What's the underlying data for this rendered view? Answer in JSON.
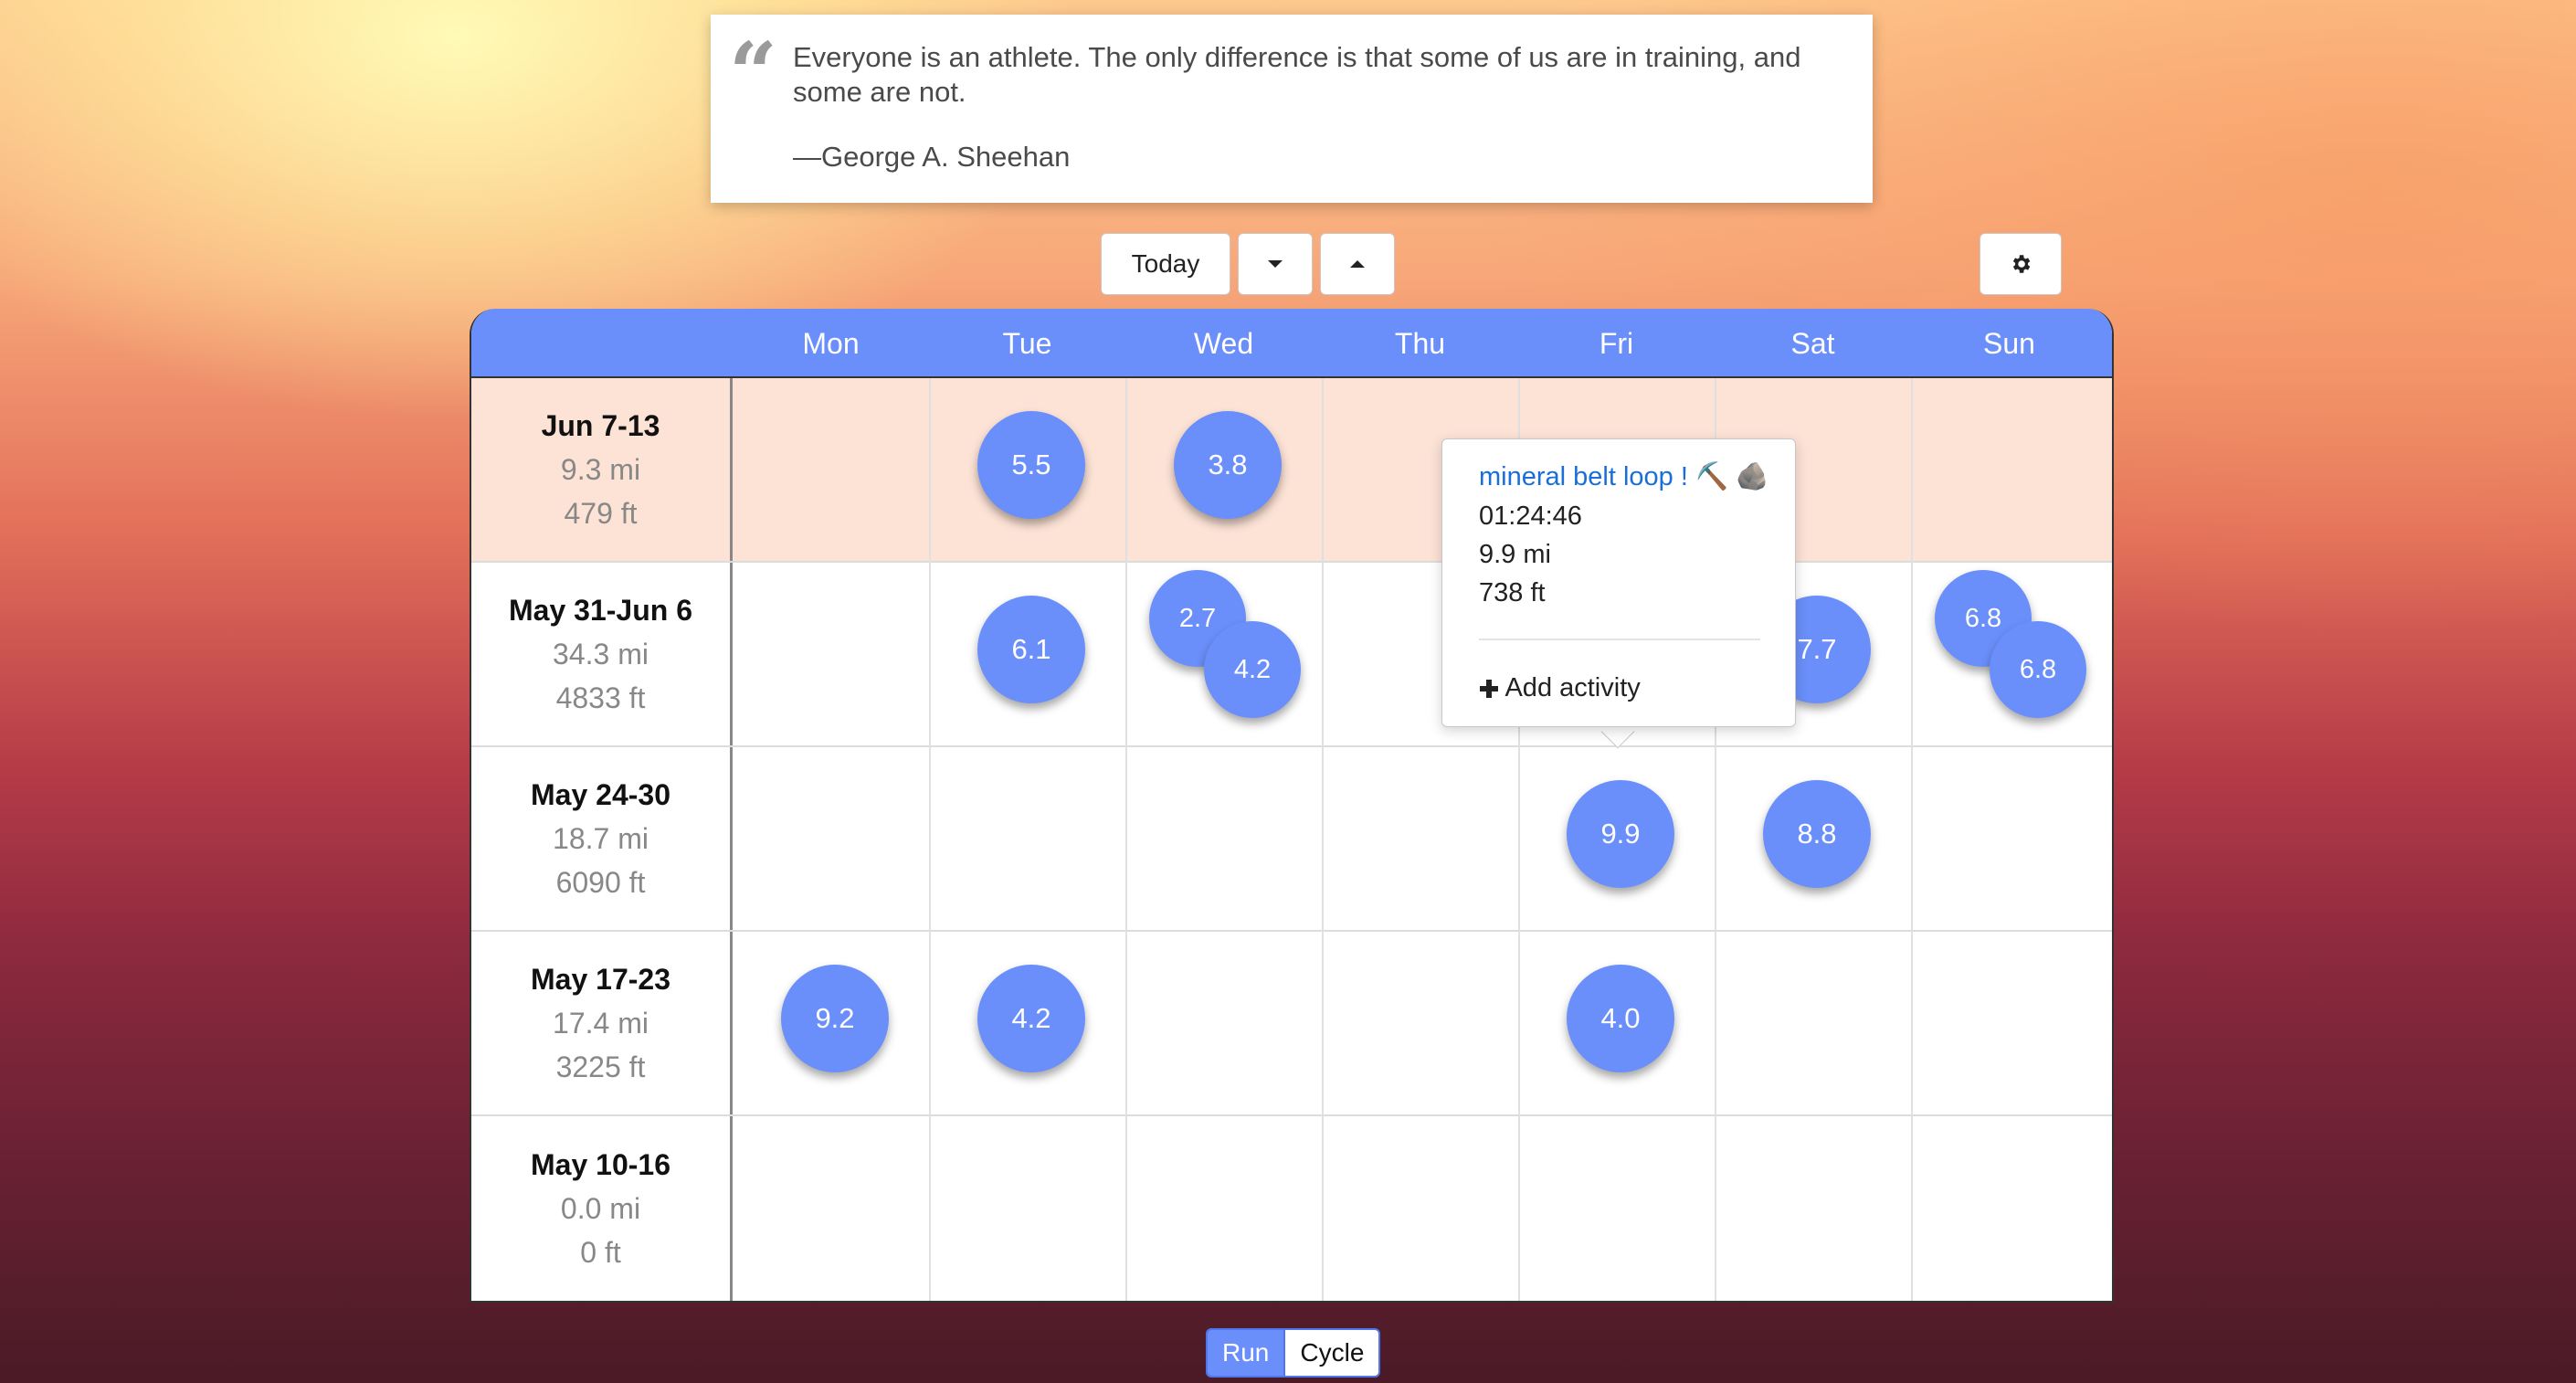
{
  "quote": {
    "mark": "“",
    "text": "Everyone is an athlete. The only difference is that some of us are in training, and some are not.",
    "author": "—George A. Sheehan"
  },
  "toolbar": {
    "today_label": "Today",
    "prev_icon": "caret-down-icon",
    "next_icon": "caret-up-icon",
    "settings_icon": "gear-icon"
  },
  "calendar": {
    "days": [
      "Mon",
      "Tue",
      "Wed",
      "Thu",
      "Fri",
      "Sat",
      "Sun"
    ],
    "weeks": [
      {
        "range": "Jun 7-13",
        "distance": "9.3 mi",
        "elevation": "479 ft",
        "current": true,
        "activities": [
          {
            "day": "Tue",
            "value": "5.5"
          },
          {
            "day": "Wed",
            "value": "3.8"
          }
        ]
      },
      {
        "range": "May 31-Jun 6",
        "distance": "34.3 mi",
        "elevation": "4833 ft",
        "activities": [
          {
            "day": "Tue",
            "value": "6.1"
          },
          {
            "day": "Wed",
            "value": "2.7"
          },
          {
            "day": "Wed",
            "value": "4.2"
          },
          {
            "day": "Sat",
            "value": "7.7"
          },
          {
            "day": "Sun",
            "value": "6.8"
          },
          {
            "day": "Sun",
            "value": "6.8"
          }
        ]
      },
      {
        "range": "May 24-30",
        "distance": "18.7 mi",
        "elevation": "6090 ft",
        "activities": [
          {
            "day": "Fri",
            "value": "9.9"
          },
          {
            "day": "Sat",
            "value": "8.8"
          }
        ]
      },
      {
        "range": "May 17-23",
        "distance": "17.4 mi",
        "elevation": "3225 ft",
        "activities": [
          {
            "day": "Mon",
            "value": "9.2"
          },
          {
            "day": "Tue",
            "value": "4.2"
          },
          {
            "day": "Fri",
            "value": "4.0"
          }
        ]
      },
      {
        "range": "May 10-16",
        "distance": "0.0 mi",
        "elevation": "0 ft",
        "activities": []
      }
    ],
    "accent_color": "#6a8ffa",
    "current_week_color": "#fde3d6"
  },
  "popover": {
    "title": "mineral belt loop ! ⛏️ 🪨",
    "duration": "01:24:46",
    "distance": "9.9 mi",
    "elevation": "738 ft",
    "add_label": "Add activity",
    "add_icon": "plus-icon"
  },
  "sport_toggle": {
    "run_label": "Run",
    "cycle_label": "Cycle",
    "selected": "Run"
  }
}
